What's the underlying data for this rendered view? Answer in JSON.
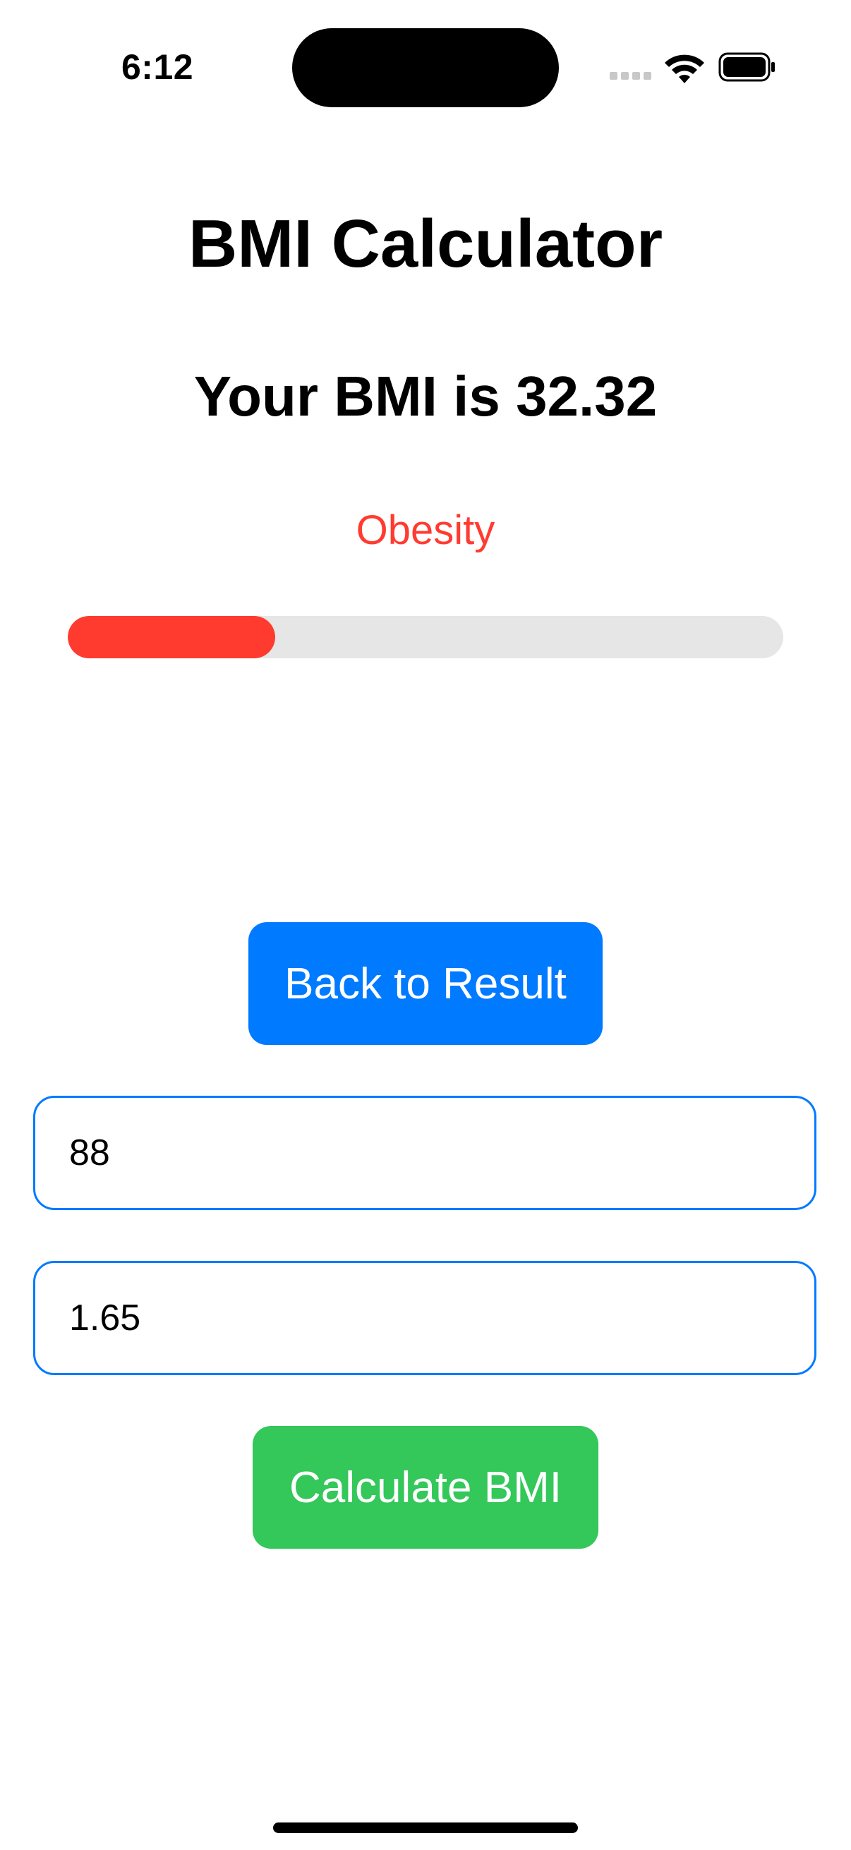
{
  "status_bar": {
    "time": "6:12",
    "icons": [
      "signal-icon",
      "wifi-icon",
      "battery-icon"
    ]
  },
  "app": {
    "title": "BMI Calculator",
    "result_text": "Your BMI is 32.32",
    "category": "Obesity",
    "category_color": "#ff3b30",
    "progress_fraction": 0.29
  },
  "buttons": {
    "back_label": "Back to Result",
    "back_color": "#007aff",
    "calculate_label": "Calculate BMI",
    "calculate_color": "#34c759"
  },
  "inputs": {
    "weight_value": "88",
    "height_value": "1.65"
  }
}
